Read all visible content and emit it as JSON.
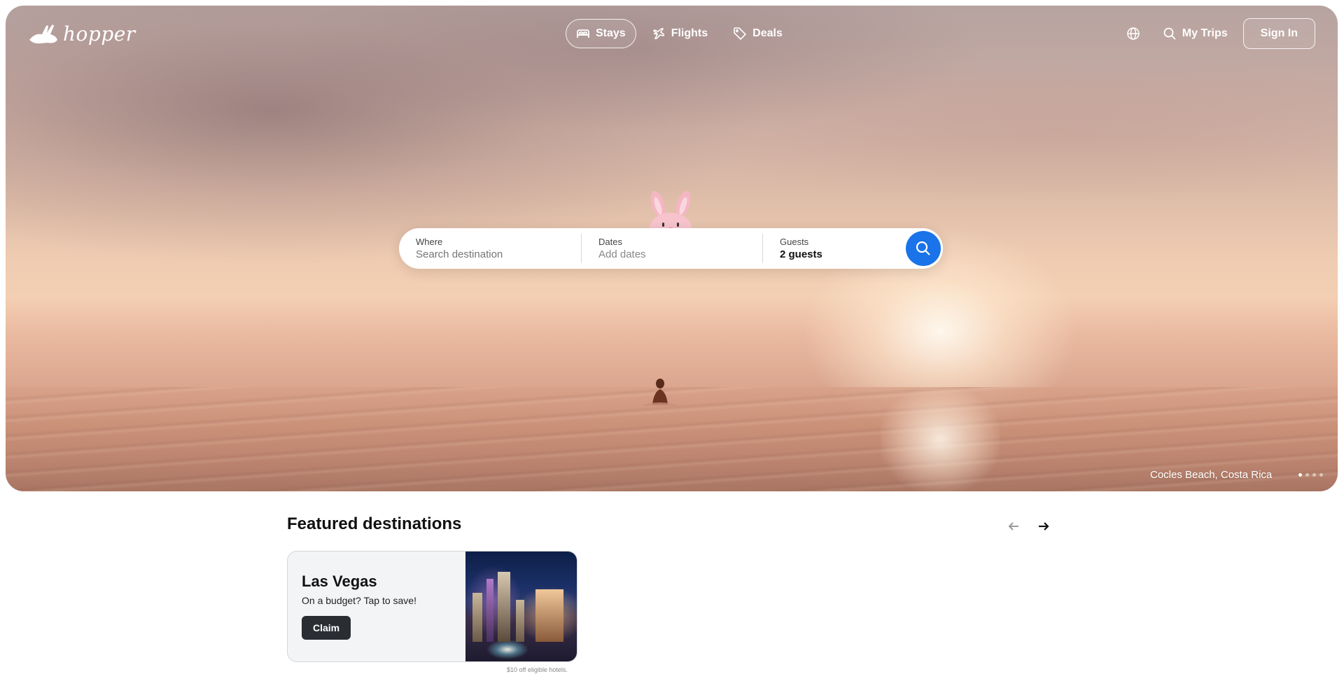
{
  "brand": {
    "name": "hopper",
    "accent": "#1a73e8"
  },
  "nav": {
    "tabs": [
      {
        "label": "Stays",
        "icon": "bed-icon",
        "active": true
      },
      {
        "label": "Flights",
        "icon": "plane-icon",
        "active": false
      },
      {
        "label": "Deals",
        "icon": "tag-icon",
        "active": false
      }
    ],
    "globe_icon": "globe-icon",
    "my_trips": "My Trips",
    "sign_in": "Sign In"
  },
  "search": {
    "where_label": "Where",
    "where_placeholder": "Search destination",
    "dates_label": "Dates",
    "dates_placeholder": "Add dates",
    "guests_label": "Guests",
    "guests_value": "2 guests"
  },
  "hero": {
    "caption": "Cocles Beach, Costa Rica",
    "slide_count": 4,
    "active_slide": 1
  },
  "featured": {
    "title": "Featured destinations",
    "cards": [
      {
        "title": "Las Vegas",
        "subtitle": "On a budget? Tap to save!",
        "button": "Claim",
        "disclaimer": "$10 off eligible hotels."
      }
    ]
  }
}
